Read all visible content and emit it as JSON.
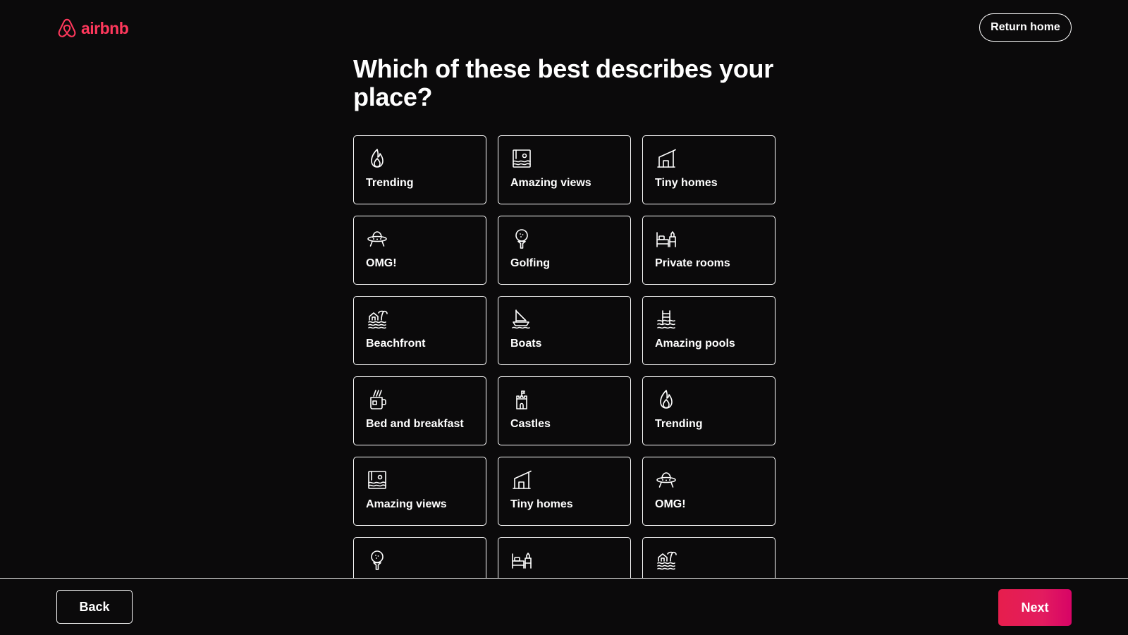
{
  "header": {
    "logo_text": "airbnb",
    "return_home_label": "Return home"
  },
  "main": {
    "title": "Which of these best describes your place?",
    "categories": [
      {
        "label": "Trending",
        "icon": "flame-icon"
      },
      {
        "label": "Amazing views",
        "icon": "views-icon"
      },
      {
        "label": "Tiny homes",
        "icon": "tiny-home-icon"
      },
      {
        "label": "OMG!",
        "icon": "ufo-icon"
      },
      {
        "label": "Golfing",
        "icon": "golf-ball-icon"
      },
      {
        "label": "Private rooms",
        "icon": "bed-icon"
      },
      {
        "label": "Beachfront",
        "icon": "beachfront-icon"
      },
      {
        "label": "Boats",
        "icon": "sailboat-icon"
      },
      {
        "label": "Amazing pools",
        "icon": "pool-icon"
      },
      {
        "label": "Bed and breakfast",
        "icon": "mug-icon"
      },
      {
        "label": "Castles",
        "icon": "castle-icon"
      },
      {
        "label": "Trending",
        "icon": "flame-icon"
      },
      {
        "label": "Amazing views",
        "icon": "views-icon"
      },
      {
        "label": "Tiny homes",
        "icon": "tiny-home-icon"
      },
      {
        "label": "OMG!",
        "icon": "ufo-icon"
      },
      {
        "label": "",
        "icon": "golf-ball-icon"
      },
      {
        "label": "",
        "icon": "bed-icon"
      },
      {
        "label": "",
        "icon": "beachfront-icon"
      }
    ]
  },
  "footer": {
    "back_label": "Back",
    "next_label": "Next"
  },
  "colors": {
    "background": "#0b0a0b",
    "brand": "#ff385c",
    "next_button": "#e31c5f"
  }
}
